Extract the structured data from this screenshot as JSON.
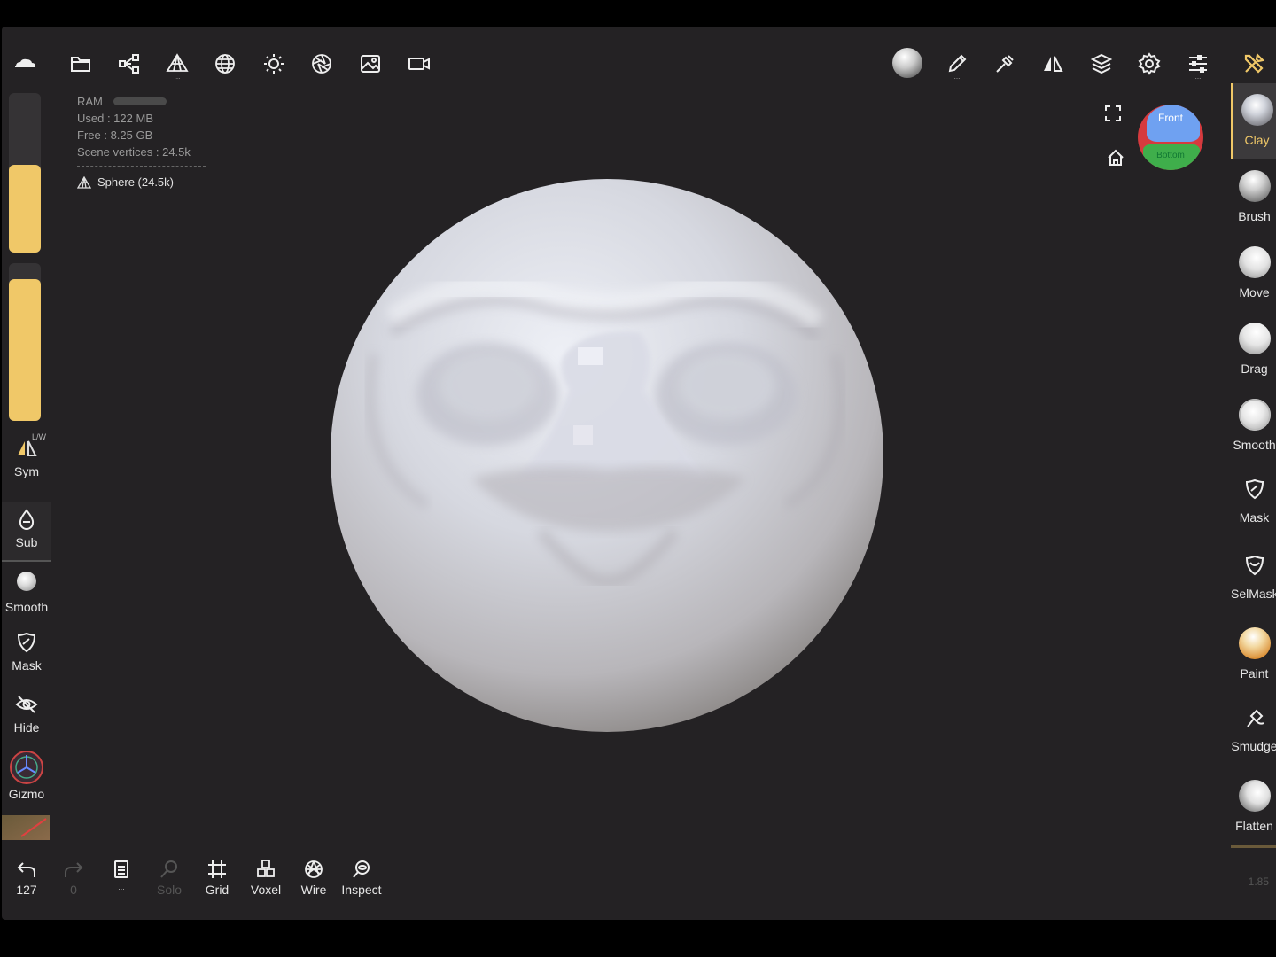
{
  "top_toolbar": {
    "left_icons": [
      "cloud-icon",
      "folder-icon",
      "scene-graph-icon",
      "mesh-pyramid-icon",
      "topology-sphere-icon",
      "sun-icon",
      "material-aperture-icon",
      "image-icon",
      "video-camera-icon"
    ],
    "right_icons": [
      "material-ball-icon",
      "pen-icon",
      "picker-icon",
      "symmetry-icon",
      "layers-icon",
      "gear-icon",
      "sliders-icon",
      "tools-icon"
    ]
  },
  "info_panel": {
    "ram_label": "RAM",
    "used": "Used : 122 MB",
    "free": "Free : 8.25 GB",
    "vertices": "Scene vertices : 24.5k",
    "mesh_item": "Sphere (24.5k)"
  },
  "left_toolbar": {
    "sliders": {
      "size_level": 0.55,
      "intensity_level": 0.9
    },
    "sym_label": "Sym",
    "sym_tag": "L/W",
    "sub_label": "Sub",
    "smooth_label": "Smooth",
    "mask_label": "Mask",
    "hide_label": "Hide",
    "gizmo_label": "Gizmo"
  },
  "right_toolbar": {
    "tools": [
      "Clay",
      "Brush",
      "Move",
      "Drag",
      "Smooth",
      "Mask",
      "SelMask",
      "Paint",
      "Smudge",
      "Flatten"
    ],
    "selected": "Clay"
  },
  "navcube": {
    "front": "Front",
    "bottom": "Bottom"
  },
  "bottom_toolbar": {
    "undo_count": "127",
    "redo_count": "0",
    "solo_label": "Solo",
    "grid_label": "Grid",
    "voxel_label": "Voxel",
    "wire_label": "Wire",
    "inspect_label": "Inspect",
    "more": "..."
  },
  "version": "1.85",
  "colors": {
    "accent": "#f0c868",
    "background": "#242224",
    "sculpt_base": "#d9dae2"
  }
}
